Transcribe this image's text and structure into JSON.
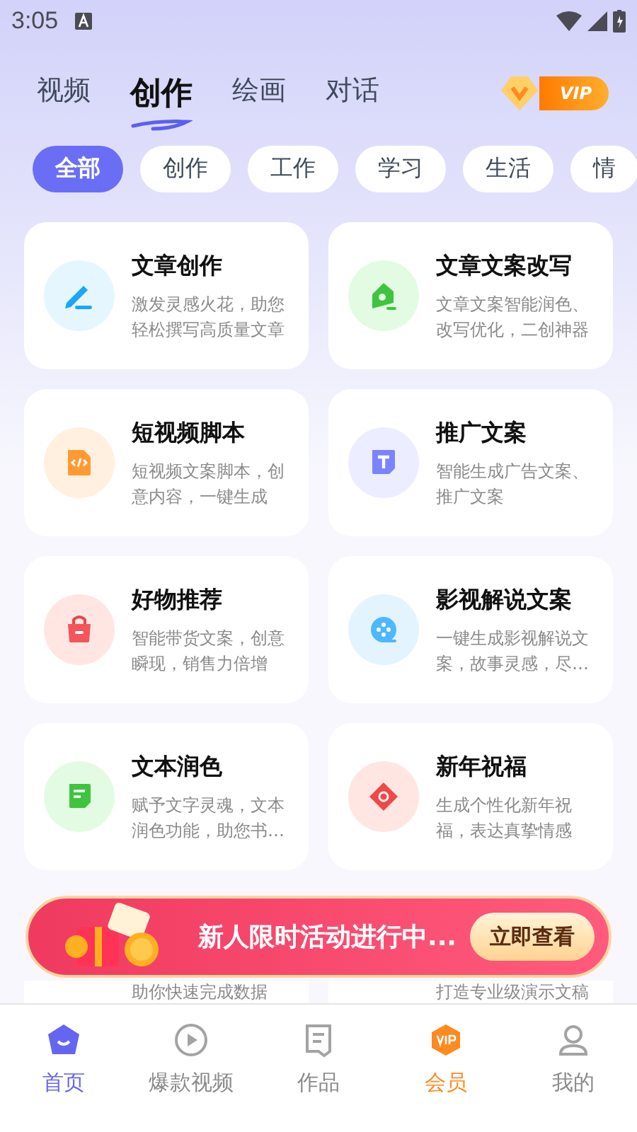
{
  "status_bar": {
    "time": "3:05"
  },
  "top_tabs": [
    {
      "label": "视频",
      "selected": false
    },
    {
      "label": "创作",
      "selected": true
    },
    {
      "label": "绘画",
      "selected": false
    },
    {
      "label": "对话",
      "selected": false
    }
  ],
  "vip_badge": {
    "label": "VIP"
  },
  "chips": [
    {
      "label": "全部",
      "selected": true
    },
    {
      "label": "创作",
      "selected": false
    },
    {
      "label": "工作",
      "selected": false
    },
    {
      "label": "学习",
      "selected": false
    },
    {
      "label": "生活",
      "selected": false
    },
    {
      "label": "情",
      "selected": false
    }
  ],
  "cards": [
    {
      "kind": "pen",
      "title": "文章创作",
      "description": "激发灵感火花，助您轻松撰写高质量文章"
    },
    {
      "kind": "house",
      "title": "文章文案改写",
      "description": "文章文案智能润色、改写优化，二创神器"
    },
    {
      "kind": "code",
      "title": "短视频脚本",
      "description": "短视频文案脚本，创意内容，一键生成"
    },
    {
      "kind": "letter",
      "title": "推广文案",
      "description": "智能生成广告文案、推广文案"
    },
    {
      "kind": "bag",
      "title": "好物推荐",
      "description": "智能带货文案，创意瞬现，销售力倍增"
    },
    {
      "kind": "film",
      "title": "影视解说文案",
      "description": "一键生成影视解说文案，故事灵感，尽…"
    },
    {
      "kind": "note",
      "title": "文本润色",
      "description": "赋予文字灵魂，文本润色功能，助您书…"
    },
    {
      "kind": "fu",
      "title": "新年祝福",
      "description": "生成个性化新年祝福，表达真挚情感"
    },
    {
      "description": "助你快速完成数据"
    },
    {
      "description": "打造专业级演示文稿"
    }
  ],
  "promo_banner": {
    "text": "新人限时活动进行中...",
    "button": "立即查看"
  },
  "bottom_nav": [
    {
      "label": "首页",
      "selected": true,
      "kind": "home"
    },
    {
      "label": "爆款视频",
      "selected": false,
      "kind": "video"
    },
    {
      "label": "作品",
      "selected": false,
      "kind": "works"
    },
    {
      "label": "会员",
      "selected": false,
      "kind": "vip"
    },
    {
      "label": "我的",
      "selected": false,
      "kind": "me"
    }
  ]
}
